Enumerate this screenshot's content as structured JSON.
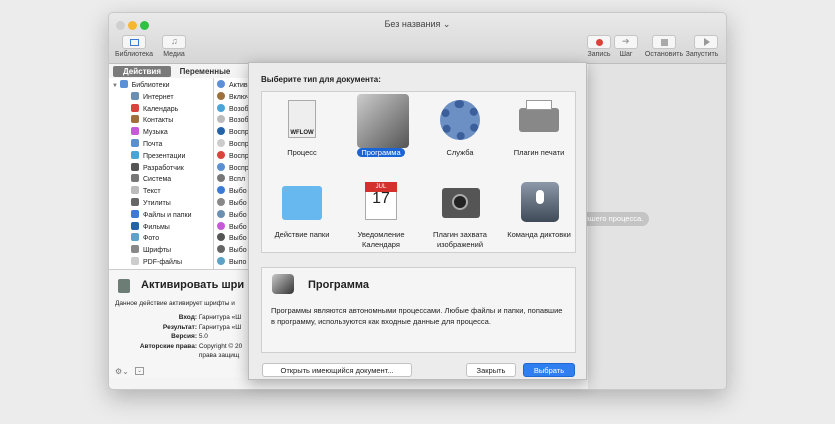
{
  "window": {
    "title": "Без названия ⌄"
  },
  "toolbar": {
    "library": "Библиотека",
    "media": "Медиа",
    "record": "Запись",
    "step": "Шаг",
    "stop": "Остановить",
    "run": "Запустить"
  },
  "tabs": {
    "actions": "Действия",
    "variables": "Переменные"
  },
  "library": [
    "Библиотеки",
    "Интернет",
    "Календарь",
    "Контакты",
    "Музыка",
    "Почта",
    "Презентации",
    "Разработчик",
    "Система",
    "Текст",
    "Утилиты",
    "Файлы и папки",
    "Фильмы",
    "Фото",
    "Шрифты",
    "PDF-файлы"
  ],
  "actions": [
    "Актив",
    "Включ",
    "Возоб",
    "Возоб",
    "Воспр",
    "Воспр",
    "Воспр",
    "Воспр",
    "Вспл",
    "Выбо",
    "Выбо",
    "Выбо",
    "Выбо",
    "Выбо",
    "Выбо",
    "Выпо"
  ],
  "info": {
    "title": "Активировать шри",
    "desc": "Данное действие активирует шрифты и",
    "input_label": "Вход:",
    "input_value": "Гарнитура «Ш",
    "result_label": "Результат:",
    "result_value": "Гарнитура «Ш",
    "version_label": "Версия:",
    "version_value": "5.0",
    "copyright_label": "Авторские права:",
    "copyright_value": "Copyright © 20",
    "copyright_value2": "права защищ"
  },
  "workflow_hint": "ния Вашего процесса.",
  "sheet": {
    "heading": "Выберите тип для документа:",
    "types": [
      {
        "label": "Процесс",
        "badge": "WFLOW"
      },
      {
        "label": "Программа"
      },
      {
        "label": "Служба"
      },
      {
        "label": "Плагин печати"
      },
      {
        "label": "Действие папки"
      },
      {
        "label": "Уведомление Календаря",
        "badge": "JUL",
        "day": "17"
      },
      {
        "label": "Плагин захвата изображений"
      },
      {
        "label": "Команда диктовки"
      }
    ],
    "selected": "Программа",
    "desc_title": "Программа",
    "desc_text": "Программы являются автономными процессами. Любые файлы и папки, попавшие в программу, используются как входные данные для процесса.",
    "open_button": "Открыть имеющийся документ...",
    "close_button": "Закрыть",
    "choose_button": "Выбрать"
  },
  "colors": {
    "accent": "#1a64d6"
  }
}
